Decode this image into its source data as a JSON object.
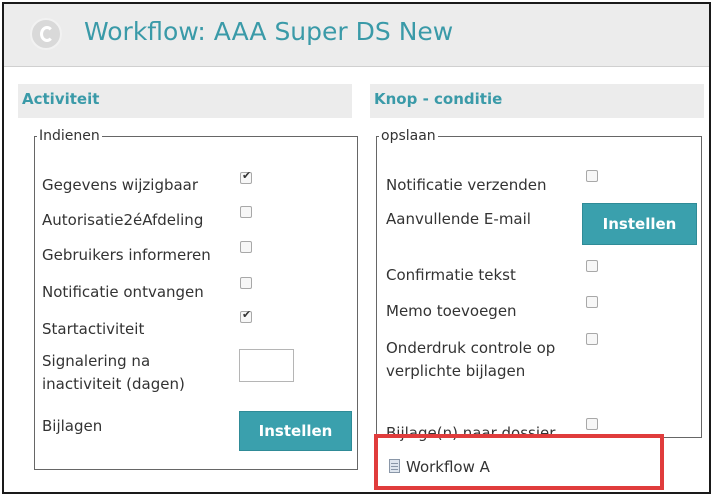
{
  "window": {
    "title": "Workflow: AAA Super DS New"
  },
  "activiteit": {
    "header": "Activiteit",
    "group_label": "Indienen",
    "rows": [
      {
        "label": "Gegevens wijzigbaar",
        "checked": true
      },
      {
        "label": "Autorisatie2éAfdeling",
        "checked": false
      },
      {
        "label": "Gebruikers informeren",
        "checked": false
      },
      {
        "label": "Notificatie ontvangen",
        "checked": false
      },
      {
        "label": "Startactiviteit",
        "checked": true
      }
    ],
    "signalering_line1": "Signalering na",
    "signalering_line2": "inactiviteit (dagen)",
    "signalering_value": "",
    "bijlagen_label": "Bijlagen",
    "bijlagen_button": "Instellen"
  },
  "knop": {
    "header": "Knop - conditie",
    "group_label": "opslaan",
    "notificatie_label": "Notificatie verzenden",
    "notificatie_checked": false,
    "email_label": "Aanvullende E-mail",
    "email_button": "Instellen",
    "confirmatie_label": "Confirmatie tekst",
    "confirmatie_checked": false,
    "memo_label": "Memo toevoegen",
    "memo_checked": false,
    "onderdruk_line1": "Onderdruk controle op",
    "onderdruk_line2": "verplichte bijlagen",
    "onderdruk_checked": false,
    "bijlage_dossier_label": "Bijlage(n) naar dossier",
    "bijlage_dossier_checked": false,
    "workflow_item": "Workflow A",
    "workflow_icon": "document-icon"
  },
  "colors": {
    "accent": "#3a9aa8",
    "button": "#3aa0ad",
    "highlight": "#e03c3c"
  }
}
